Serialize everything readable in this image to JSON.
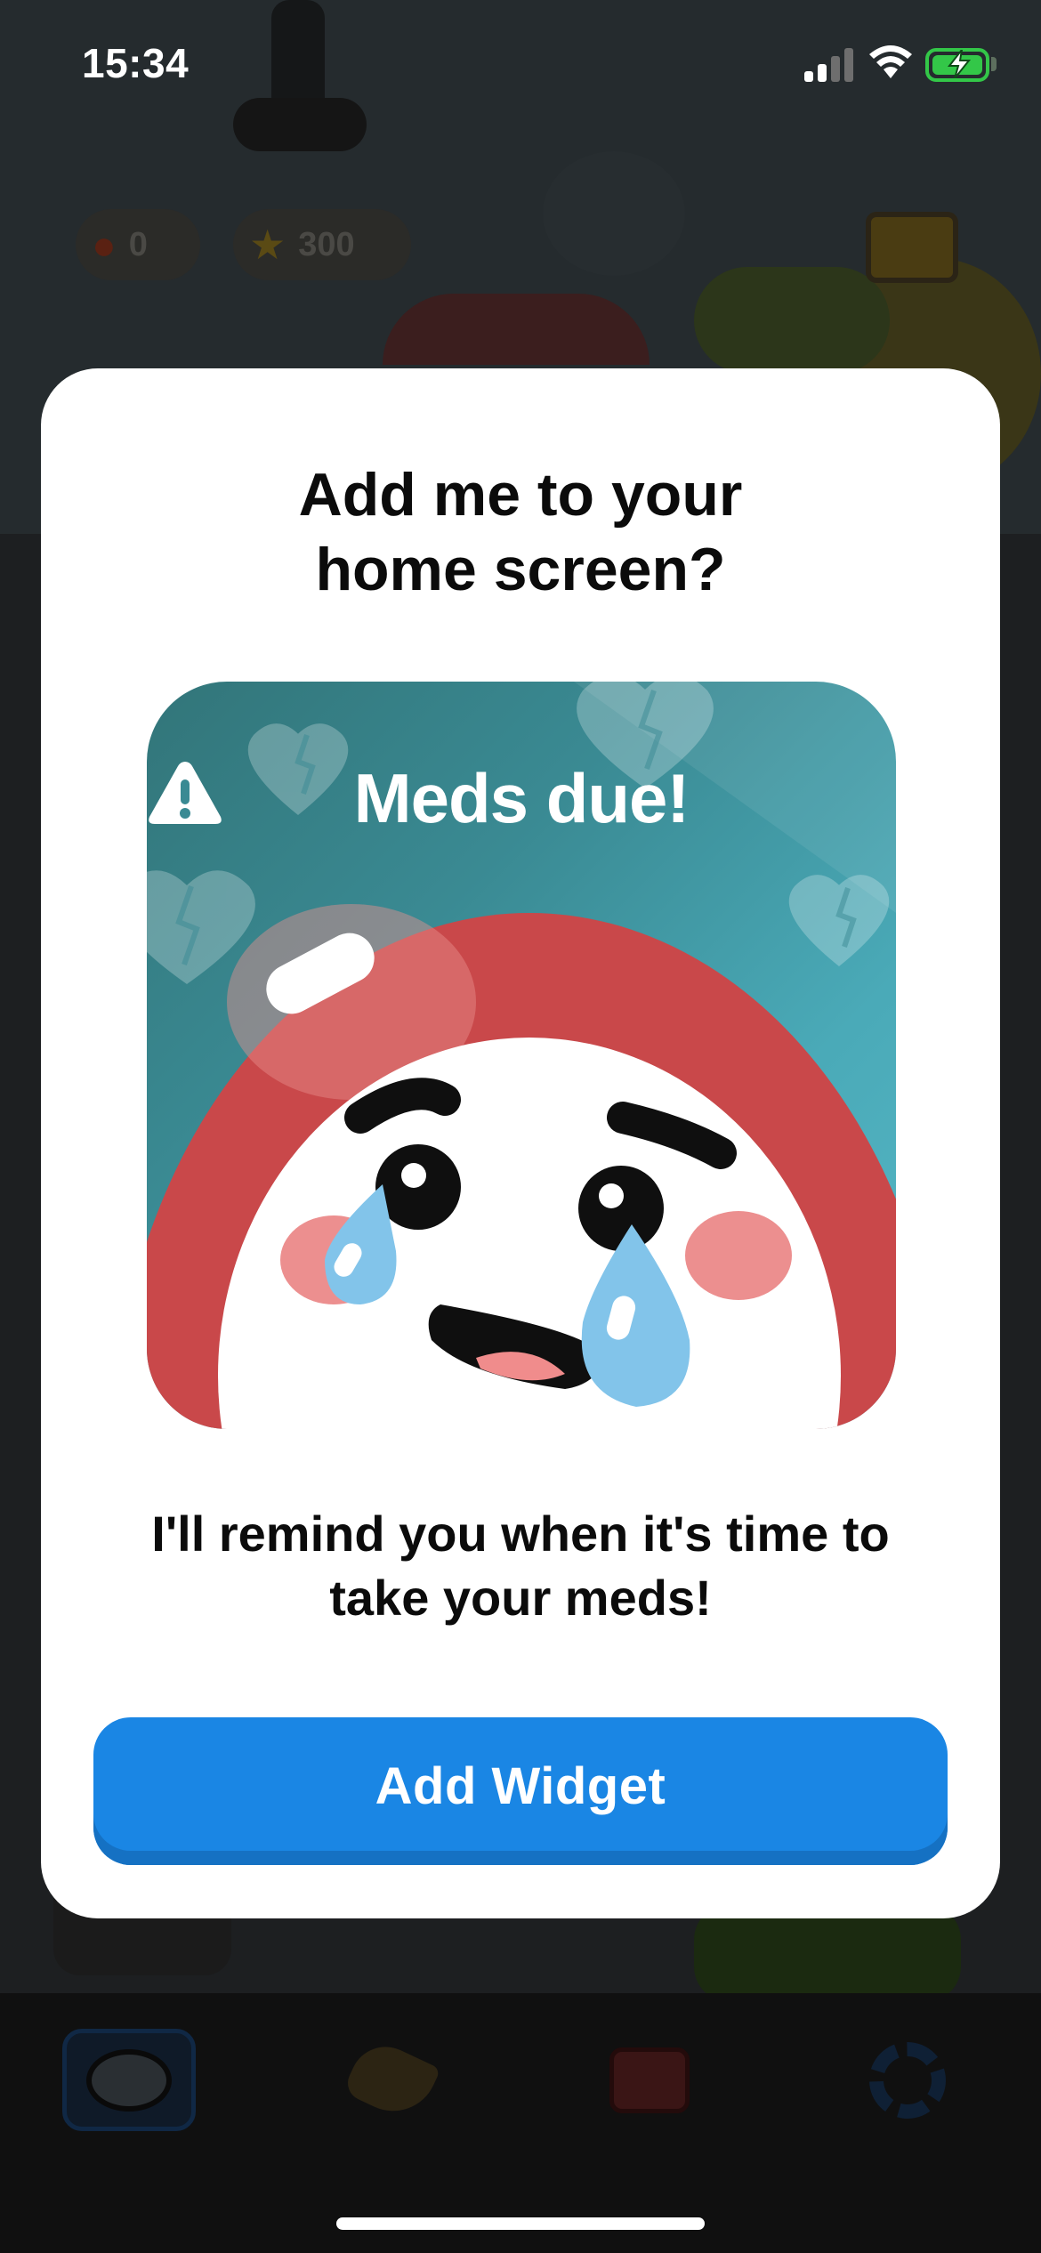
{
  "status_bar": {
    "time": "15:34",
    "battery_charging": true,
    "battery_color": "#33c748"
  },
  "background_app": {
    "streak_count": "0",
    "stars_count": "300",
    "tabs": [
      "pet-face-icon",
      "food-icon",
      "medicine-kit-icon",
      "settings-gear-icon"
    ]
  },
  "modal": {
    "title_line1": "Add me to your",
    "title_line2": "home screen?",
    "widget_preview": {
      "label": "Meds due!",
      "icon": "warning-triangle-icon",
      "background": "#3a8a93",
      "mascot_color": "#c9484a"
    },
    "body_line1": "I'll remind you when it's time to",
    "body_line2": "take your meds!",
    "button_label": "Add Widget",
    "button_color": "#1a86e4"
  }
}
